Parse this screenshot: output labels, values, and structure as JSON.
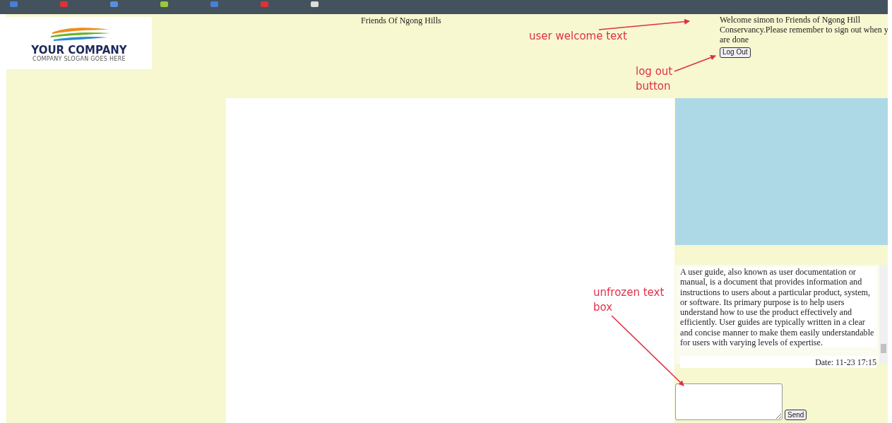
{
  "logo": {
    "name": "YOUR COMPANY",
    "slogan": "COMPANY SLOGAN GOES HERE"
  },
  "header": {
    "title": "Friends Of Ngong Hills",
    "welcome_lines": [
      "Welcome simon to Friends of Ngong Hill",
      "Conservancy.Please remember to sign out when y",
      "are done"
    ],
    "logout_button": "Log Out"
  },
  "chat": {
    "message": "A user guide, also known as user documentation or manual, is a document that provides information and instructions to users about a particular product, system, or software. Its primary purpose is to help users understand how to use the product effectively and efficiently. User guides are typically written in a clear and concise manner to make them easily understandable for users with varying levels of expertise.",
    "date": "Date: 11-23 17:15",
    "send_button": "Send"
  },
  "annotations": [
    {
      "lines": [
        "user welcome text"
      ]
    },
    {
      "lines": [
        "log out",
        "button"
      ]
    },
    {
      "lines": [
        "unfrozen text",
        "box"
      ]
    }
  ]
}
